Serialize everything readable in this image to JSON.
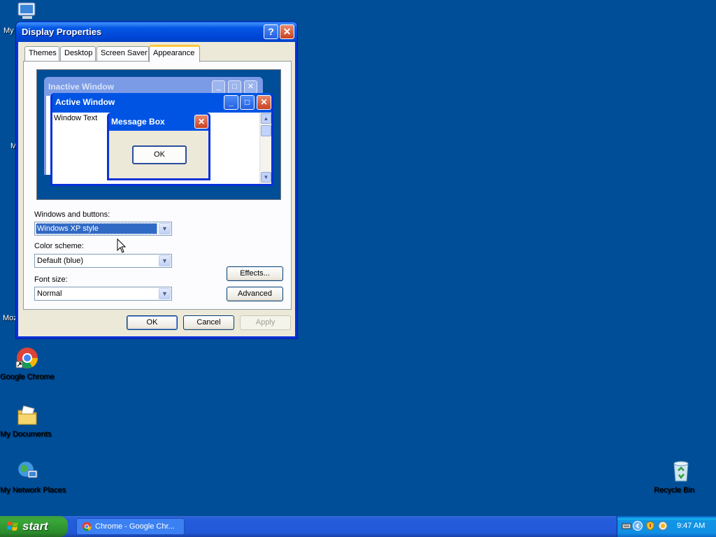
{
  "desktop": {
    "icons": [
      {
        "label": "Google Chrome",
        "icon": "chrome-icon"
      },
      {
        "label": "My Documents",
        "icon": "my-documents-icon"
      },
      {
        "label": "My Network Places",
        "icon": "network-places-icon"
      },
      {
        "label": "Recycle Bin",
        "icon": "recycle-bin-icon"
      }
    ],
    "partial_labels": [
      "My",
      "M",
      "Moz"
    ]
  },
  "dialog": {
    "title": "Display Properties",
    "help_glyph": "?",
    "close_glyph": "✕",
    "tabs": [
      {
        "label": "Themes",
        "active": false
      },
      {
        "label": "Desktop",
        "active": false
      },
      {
        "label": "Screen Saver",
        "active": false
      },
      {
        "label": "Appearance",
        "active": true
      }
    ],
    "preview": {
      "inactive_title": "Inactive Window",
      "active_title": "Active Window",
      "window_text": "Window Text",
      "message_box_title": "Message Box",
      "message_box_ok": "OK"
    },
    "windows_and_buttons": {
      "label": "Windows and buttons:",
      "value": "Windows XP style"
    },
    "color_scheme": {
      "label": "Color scheme:",
      "value": "Default (blue)"
    },
    "font_size": {
      "label": "Font size:",
      "value": "Normal"
    },
    "effects_label": "Effects...",
    "advanced_label": "Advanced",
    "ok_label": "OK",
    "cancel_label": "Cancel",
    "apply_label": "Apply"
  },
  "taskbar": {
    "start_label": "start",
    "task_button": "Chrome - Google Chr...",
    "clock": "9:47 AM"
  },
  "colors": {
    "desktop": "#004e98",
    "titlebar": "#0054e3",
    "dialog_face": "#ece9d8",
    "selection": "#316ac5",
    "start_green": "#3aa73a"
  }
}
